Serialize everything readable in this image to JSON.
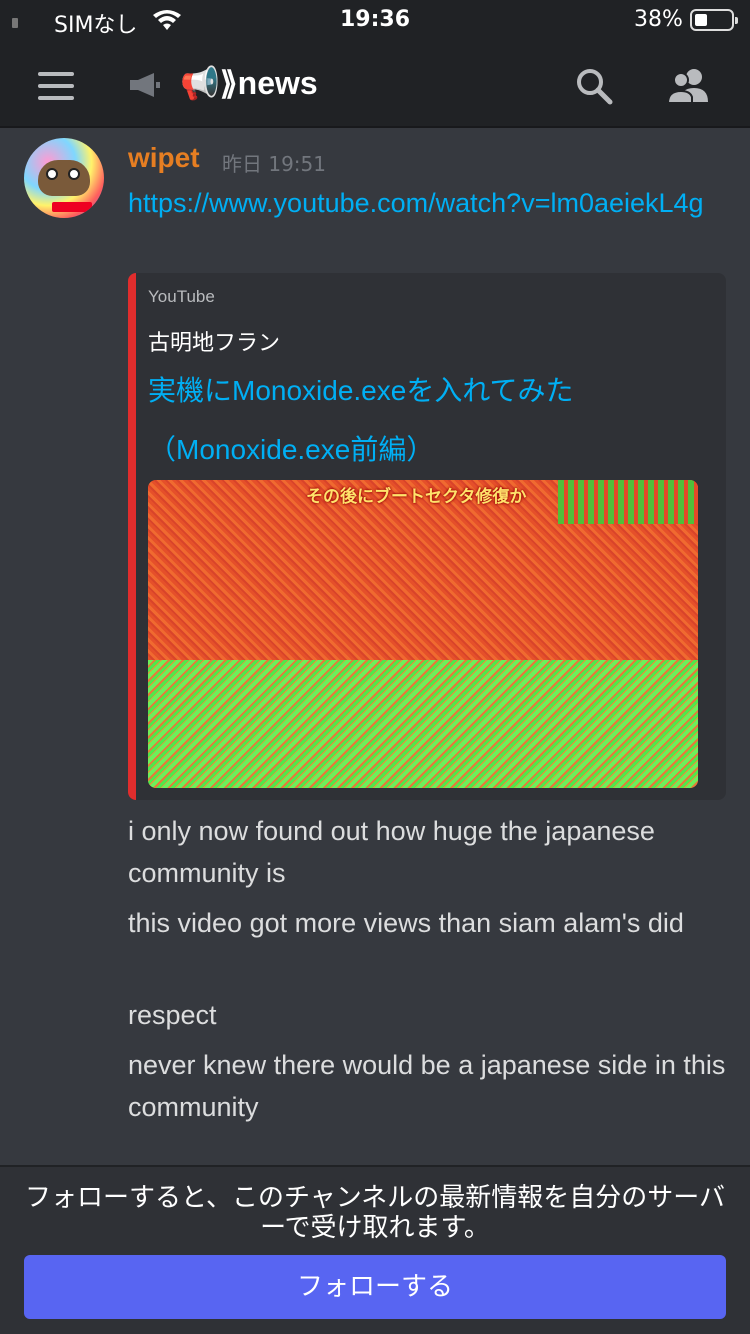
{
  "status_bar": {
    "carrier": "SIMなし",
    "time": "19:36",
    "battery": "38%",
    "battery_level": 0.38
  },
  "header": {
    "channel_name": "📢⟫news",
    "icons": [
      "menu-icon",
      "announcement-icon",
      "search-icon",
      "members-icon"
    ]
  },
  "message": {
    "author": "wipet",
    "author_color": "#e67e22",
    "timestamp": "昨日 19:51",
    "link": "https://www.youtube.com/watch?v=lm0aeiekL4g",
    "embed": {
      "provider": "YouTube",
      "author": "古明地フラン",
      "title": "実機にMonoxide.exeを入れてみた（Monoxide.exe前編）",
      "thumbnail_caption": "その後にブートセクタ修復か",
      "accent_color": "#e02d2d"
    },
    "lines": [
      "i only now found out how huge the japanese community is",
      "this video got more views than siam alam's did",
      "respect",
      "never knew there would be a japanese side in this community"
    ]
  },
  "footer": {
    "notice": "フォローすると、このチャンネルの最新情報を自分のサーバーで受け取れます。",
    "follow_label": "フォローする",
    "button_color": "#5865f2"
  }
}
